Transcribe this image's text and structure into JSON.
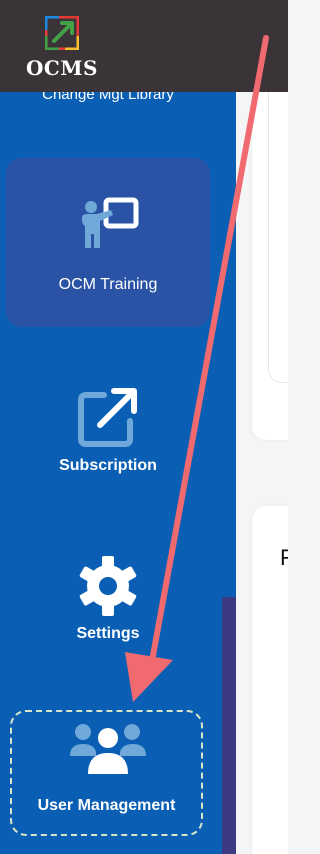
{
  "app": {
    "logo_text": "OCMS",
    "logo_name": "ocms-logo"
  },
  "sidebar": {
    "items": [
      {
        "label": "Change Mgt Library",
        "icon": "library-icon",
        "active": false
      },
      {
        "label": "OCM Training",
        "icon": "presentation-icon",
        "active": true
      },
      {
        "label": "Subscription",
        "icon": "external-link-icon",
        "active": false
      },
      {
        "label": "Settings",
        "icon": "gear-icon",
        "active": false
      },
      {
        "label": "User Management",
        "icon": "users-icon",
        "active": false,
        "focused": true
      }
    ]
  },
  "main": {
    "card2_heading_fragment": "F"
  },
  "colors": {
    "topbar": "#3a3438",
    "sidebar": "#0a5fb4",
    "active_item": "#2a53a6",
    "icon_light": "#6fa8d9",
    "annotation_arrow": "#f06a6f"
  }
}
